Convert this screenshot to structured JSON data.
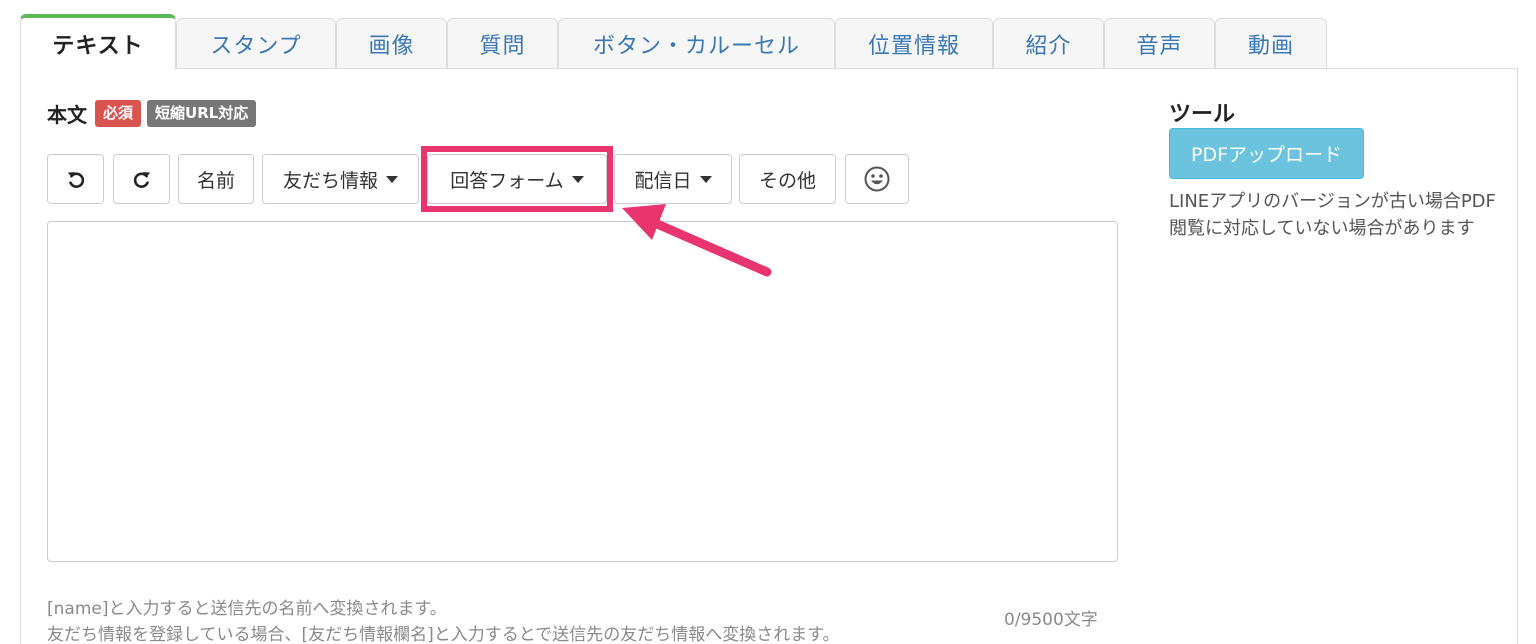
{
  "tabs": [
    {
      "label": "テキスト",
      "active": true
    },
    {
      "label": "スタンプ"
    },
    {
      "label": "画像"
    },
    {
      "label": "質問"
    },
    {
      "label": "ボタン・カルーセル"
    },
    {
      "label": "位置情報"
    },
    {
      "label": "紹介"
    },
    {
      "label": "音声"
    },
    {
      "label": "動画"
    }
  ],
  "body_label": {
    "title": "本文",
    "required_badge": "必須",
    "short_url_badge": "短縮URL対応"
  },
  "toolbar": {
    "undo_icon": "undo-icon",
    "redo_icon": "redo-icon",
    "name": "名前",
    "friend_info": "友だち情報",
    "answer_form": "回答フォーム",
    "delivery_date": "配信日",
    "other": "その他",
    "emoji_icon": "smiley-icon"
  },
  "editor": {
    "value": "",
    "counter": "0/9500文字"
  },
  "help": {
    "line1": "[name]と入力すると送信先の名前へ変換されます。",
    "line2": "友だち情報を登録している場合、[友だち情報欄名]と入力するとで送信先の友だち情報へ変換されます。"
  },
  "tools": {
    "title": "ツール",
    "pdf_upload": "PDFアップロード",
    "note": "LINEアプリのバージョンが古い場合PDF閲覧に対応していない場合があります"
  },
  "colors": {
    "highlight": "#e8356e",
    "active_tab_top": "#5cb85c",
    "tab_link": "#3a78b5",
    "pdf_button": "#6cc3de",
    "badge_required": "#d9534f",
    "badge_gray": "#777777"
  }
}
